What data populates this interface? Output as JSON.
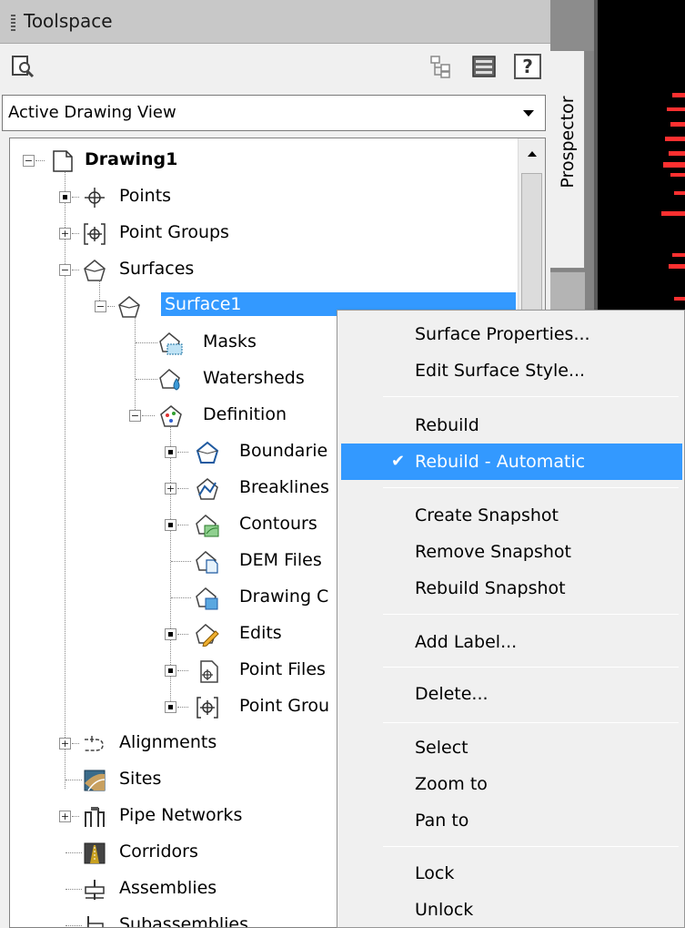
{
  "palette": {
    "title": "Toolspace",
    "tab_prospector": "Prospector",
    "view_select": {
      "value": "Active Drawing View"
    },
    "help_label": "?"
  },
  "tree": {
    "root": "Drawing1",
    "points": "Points",
    "point_groups": "Point Groups",
    "surfaces": "Surfaces",
    "surface1": "Surface1",
    "masks": "Masks",
    "watersheds": "Watersheds",
    "definition": "Definition",
    "boundaries": "Boundarie",
    "breaklines": "Breaklines",
    "contours": "Contours",
    "dem_files": "DEM Files",
    "drawing_objects": "Drawing C",
    "edits": "Edits",
    "point_files": "Point Files",
    "point_groups_def": "Point Grou",
    "alignments": "Alignments",
    "sites": "Sites",
    "pipe_networks": "Pipe Networks",
    "corridors": "Corridors",
    "assemblies": "Assemblies",
    "subassemblies": "Subassemblies"
  },
  "context_menu": {
    "surface_properties": "Surface Properties...",
    "edit_surface_style": "Edit Surface Style...",
    "rebuild": "Rebuild",
    "rebuild_automatic": "Rebuild - Automatic",
    "rebuild_automatic_checked": true,
    "create_snapshot": "Create Snapshot",
    "remove_snapshot": "Remove Snapshot",
    "rebuild_snapshot": "Rebuild Snapshot",
    "add_label": "Add Label...",
    "delete": "Delete...",
    "select": "Select",
    "zoom_to": "Zoom to",
    "pan_to": "Pan to",
    "lock": "Lock",
    "unlock": "Unlock"
  },
  "colors": {
    "selection": "#3399ff",
    "canvas_bg": "#000000",
    "canvas_marks": "#ff3030"
  }
}
